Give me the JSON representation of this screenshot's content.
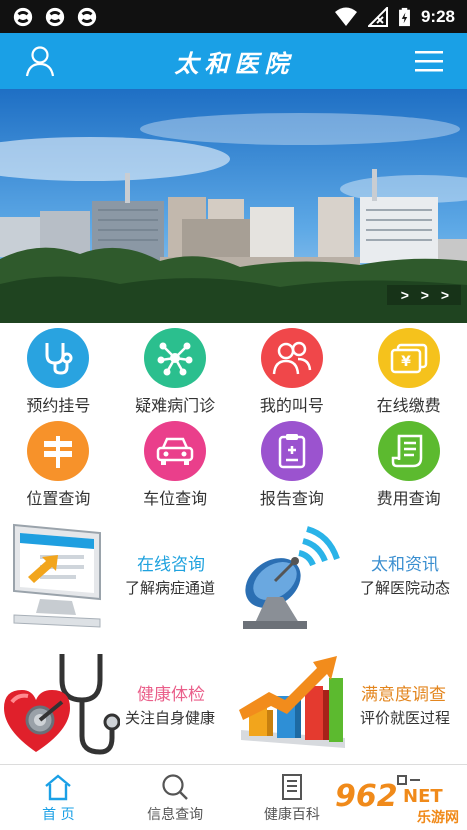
{
  "status_bar": {
    "time": "9:28",
    "left_icons": [
      "app-notification-icon",
      "app-notification-icon",
      "app-notification-icon"
    ],
    "right_icons": [
      "wifi-icon",
      "no-signal-icon",
      "battery-charging-icon"
    ]
  },
  "header": {
    "title": "太和医院",
    "left_icon": "user-icon",
    "right_icon": "menu-icon",
    "color": "#1aa0e6"
  },
  "banner": {
    "more_label": "> > >"
  },
  "grid": {
    "items": [
      {
        "label": "预约挂号",
        "icon": "stethoscope-icon",
        "color": "#29a3e0"
      },
      {
        "label": "疑难病门诊",
        "icon": "molecule-icon",
        "color": "#2bbf8e"
      },
      {
        "label": "我的叫号",
        "icon": "people-icon",
        "color": "#f0474a"
      },
      {
        "label": "在线缴费",
        "icon": "money-icon",
        "color": "#f5c21c"
      },
      {
        "label": "位置查询",
        "icon": "signpost-icon",
        "color": "#f7922a"
      },
      {
        "label": "车位查询",
        "icon": "car-icon",
        "color": "#ea3f8b"
      },
      {
        "label": "报告查询",
        "icon": "report-icon",
        "color": "#9b53cf"
      },
      {
        "label": "费用查询",
        "icon": "receipt-icon",
        "color": "#5cba2f"
      }
    ]
  },
  "promos": [
    {
      "title": "在线咨询",
      "subtitle": "了解病症通道",
      "title_color": "#1fa2de",
      "icon": "computer-icon"
    },
    {
      "title": "太和资讯",
      "subtitle": "了解医院动态",
      "title_color": "#3b8fd0",
      "icon": "satellite-dish-icon"
    },
    {
      "title": "健康体检",
      "subtitle": "关注自身健康",
      "title_color": "#ea5f8a",
      "icon": "heart-stethoscope-icon"
    },
    {
      "title": "满意度调查",
      "subtitle": "评价就医过程",
      "title_color": "#e3861f",
      "icon": "bar-chart-icon"
    }
  ],
  "bottom_nav": {
    "items": [
      {
        "label": "首 页",
        "icon": "home-icon",
        "active": true
      },
      {
        "label": "信息查询",
        "icon": "search-icon",
        "active": false
      },
      {
        "label": "健康百科",
        "icon": "book-icon",
        "active": false
      },
      {
        "label": "",
        "icon": "more-icon",
        "active": false
      }
    ]
  },
  "watermark": {
    "text": "962",
    "suffix": "NET",
    "site": "乐游网"
  }
}
